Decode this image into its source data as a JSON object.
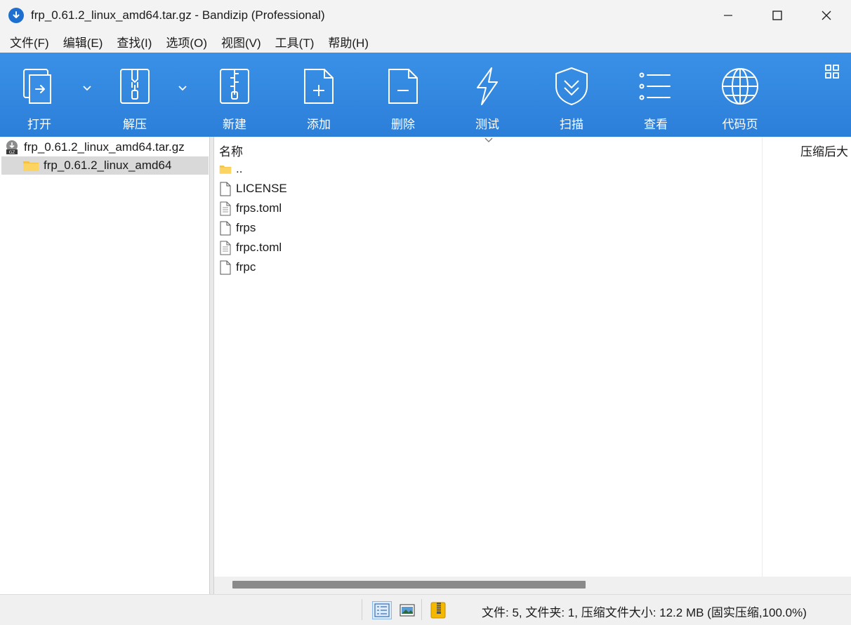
{
  "window": {
    "title": "frp_0.61.2_linux_amd64.tar.gz - Bandizip (Professional)",
    "minimize_icon": "minimize-icon",
    "maximize_icon": "maximize-icon",
    "close_icon": "close-icon"
  },
  "menu": [
    "文件(F)",
    "编辑(E)",
    "查找(I)",
    "选项(O)",
    "视图(V)",
    "工具(T)",
    "帮助(H)"
  ],
  "toolbar": {
    "open": "打开",
    "extract": "解压",
    "new": "新建",
    "add": "添加",
    "delete": "删除",
    "test": "测试",
    "scan": "扫描",
    "view": "查看",
    "codepage": "代码页"
  },
  "tree": {
    "archive": "frp_0.61.2_linux_amd64.tar.gz",
    "folder": "frp_0.61.2_linux_amd64",
    "archive_badge": "GZ"
  },
  "list": {
    "col_name": "名称",
    "col_size": "压缩后大",
    "files": [
      {
        "name": "..",
        "icon": "folder-icon"
      },
      {
        "name": "LICENSE",
        "icon": "file-icon"
      },
      {
        "name": "frps.toml",
        "icon": "text-file-icon"
      },
      {
        "name": "frps",
        "icon": "file-icon"
      },
      {
        "name": "frpc.toml",
        "icon": "text-file-icon"
      },
      {
        "name": "frpc",
        "icon": "file-icon"
      }
    ]
  },
  "status": {
    "summary": "文件: 5, 文件夹: 1, 压缩文件大小: 12.2 MB (固实压缩,100.0%)"
  },
  "colors": {
    "toolbar": "#2c7fd9",
    "selection": "#d9d9d9",
    "folder": "#f5c242"
  }
}
